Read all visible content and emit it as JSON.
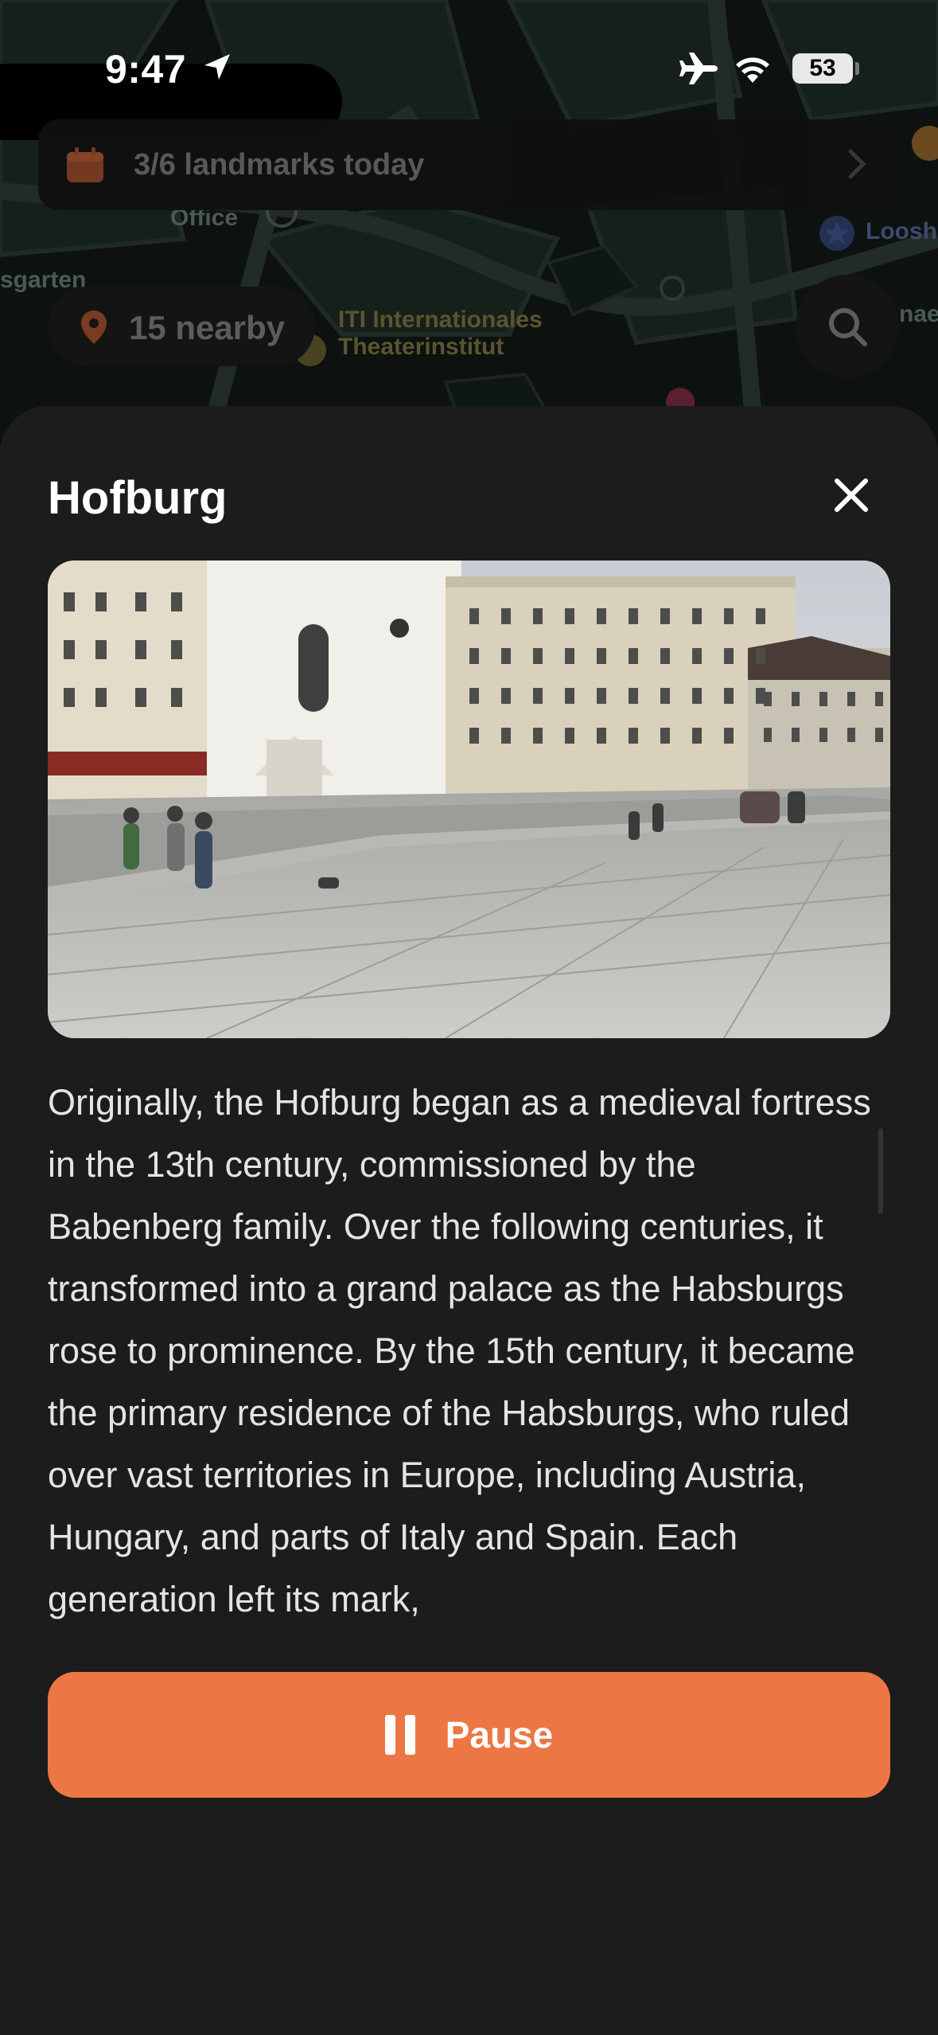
{
  "status_bar": {
    "time": "9:47",
    "battery_level": "53",
    "icons": [
      "location-arrow-icon",
      "airplane-icon",
      "wifi-icon",
      "battery-icon"
    ]
  },
  "map": {
    "labels": {
      "office": "Office",
      "garten": "sgarten",
      "iti": "ITI Internationales Theaterinstitut",
      "loos": "Loosh",
      "nae": "nae"
    },
    "landmarks_banner": {
      "text": "3/6 landmarks today",
      "icon": "calendar-icon",
      "chevron": "chevron-right-icon"
    },
    "nearby": {
      "text": "15 nearby",
      "icon": "map-pin-icon"
    },
    "search_icon": "search-icon"
  },
  "sheet": {
    "title": "Hofburg",
    "close_icon": "close-icon",
    "image_alt": "Hofburg plaza with Michaelerkirche and historic buildings",
    "description": "Originally, the Hofburg began as a medieval fortress in the 13th century, commissioned by the Babenberg family. Over the following centuries, it transformed into a grand palace as the Habsburgs rose to prominence. By the 15th century, it became the primary residence of the Habsburgs, who ruled over vast territories in Europe, including Austria, Hungary, and parts of Italy and Spain. Each generation left its mark,",
    "pause_label": "Pause",
    "pause_icon": "pause-icon"
  },
  "colors": {
    "accent": "#ec7744",
    "sheet_bg": "#1c1c1c",
    "map_bg": "#0d1210"
  }
}
